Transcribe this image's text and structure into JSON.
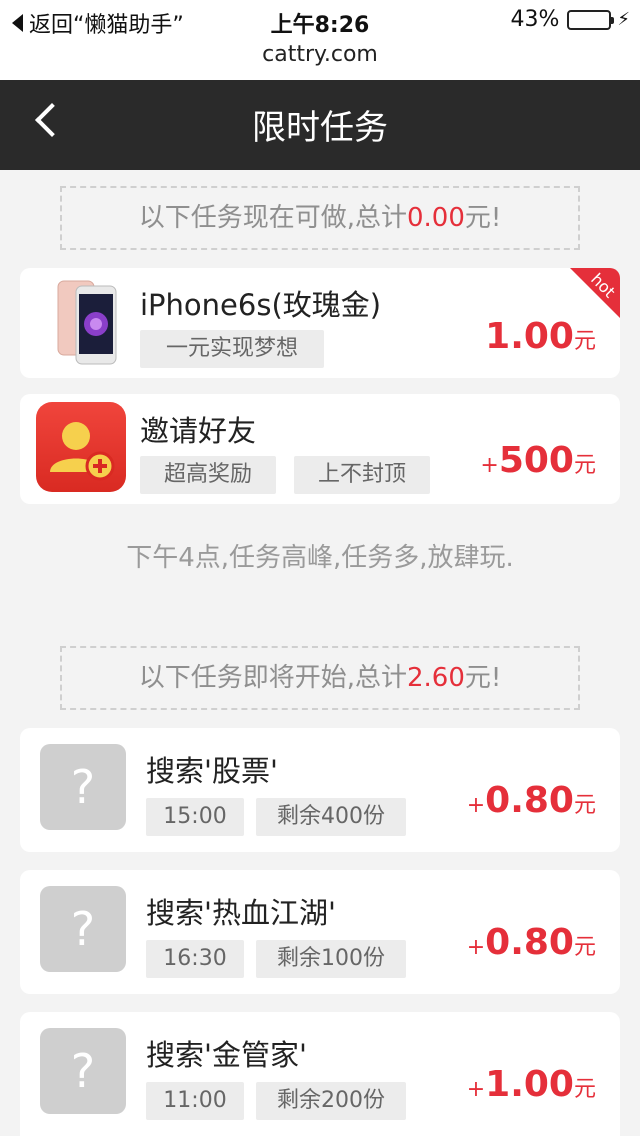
{
  "status_bar": {
    "back_app": "返回“懒猫助手”",
    "time": "上午8:26",
    "battery": "43%",
    "battery_level": 0.43
  },
  "url": "cattry.com",
  "nav": {
    "title": "限时任务"
  },
  "available": {
    "prefix": "以下任务现在可做,总计",
    "amount": "0.00",
    "suffix": "元!"
  },
  "featured": [
    {
      "name": "iPhone6s(玫瑰金)",
      "tags": [
        "一元实现梦想"
      ],
      "price": "1.00",
      "unit": "元",
      "badge": "hot"
    },
    {
      "name": "邀请好友",
      "tags": [
        "超高奖励",
        "上不封顶"
      ],
      "plus": "+",
      "price": "500",
      "unit": "元"
    }
  ],
  "notice": "下午4点,任务高峰,任务多,放肆玩.",
  "upcoming_summary": {
    "prefix": "以下任务即将开始,总计",
    "amount": "2.60",
    "suffix": "元!"
  },
  "tasks": [
    {
      "name": "搜索'股票'",
      "time": "15:00",
      "remain": "剩余400份",
      "plus": "+",
      "price": "0.80",
      "unit": "元"
    },
    {
      "name": "搜索'热血江湖'",
      "time": "16:30",
      "remain": "剩余100份",
      "plus": "+",
      "price": "0.80",
      "unit": "元"
    },
    {
      "name": "搜索'金管家'",
      "time": "11:00",
      "remain": "剩余200份",
      "plus": "+",
      "price": "1.00",
      "unit": "元"
    }
  ],
  "colors": {
    "accent": "#e52f3a",
    "nav_bg": "#2a2a2a",
    "page_bg": "#f3f3f3"
  }
}
